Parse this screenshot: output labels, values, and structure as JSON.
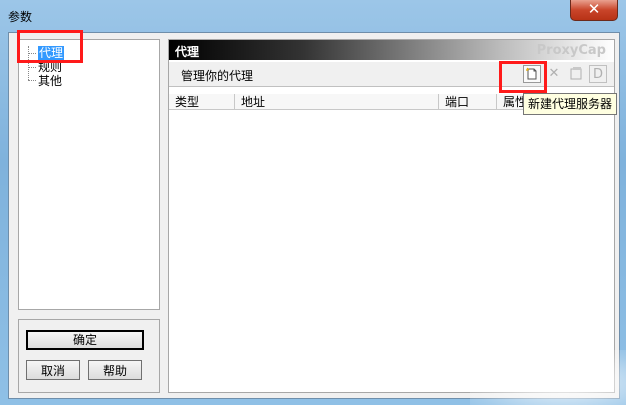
{
  "window": {
    "title": "参数",
    "close_glyph": "✕"
  },
  "tree": {
    "items": [
      {
        "label": "代理",
        "selected": true
      },
      {
        "label": "规则"
      },
      {
        "label": "其他"
      }
    ]
  },
  "buttons": {
    "ok": "确定",
    "cancel": "取消",
    "help": "帮助"
  },
  "panel": {
    "title": "代理",
    "brand": "ProxyCap",
    "subtitle": "管理你的代理",
    "toolbar": {
      "new_icon": "new-document-icon",
      "delete_icon": "delete-x-icon",
      "properties_icon": "properties-icon",
      "d_label": "D"
    }
  },
  "table": {
    "columns": [
      "类型",
      "地址",
      "端口",
      "属性"
    ]
  },
  "tooltip": {
    "text": "新建代理服务器"
  },
  "colors": {
    "selection": "#3399ff",
    "highlight_box": "#ff1a1a",
    "tooltip_bg": "#ffffe1"
  }
}
